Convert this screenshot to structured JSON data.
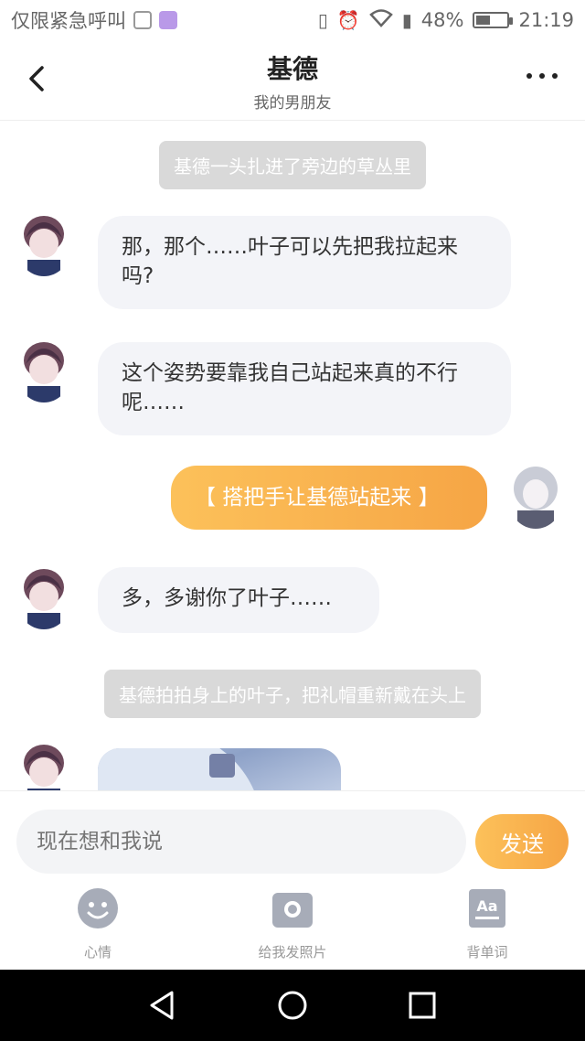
{
  "status_bar": {
    "carrier": "仅限紧急呼叫",
    "battery": "48%",
    "battery_level": 0.48,
    "time": "21:19"
  },
  "header": {
    "title": "基德",
    "subtitle": "我的男朋友"
  },
  "messages": {
    "sys1": "基德一头扎进了旁边的草丛里",
    "m1": "那，那个……叶子可以先把我拉起来吗?",
    "m2": "这个姿势要靠我自己站起来真的不行呢……",
    "m3": "【 搭把手让基德站起来 】",
    "m4": "多，多谢你了叶子……",
    "sys2": "基德拍拍身上的叶子，把礼帽重新戴在头上"
  },
  "input": {
    "placeholder": "现在想和我说",
    "send_label": "发送"
  },
  "tools": {
    "mood": "心情",
    "photo": "给我发照片",
    "words": "背单词"
  },
  "colors": {
    "accent_start": "#fcc15a",
    "accent_end": "#f6a545",
    "bubble_bg": "#f3f4f8",
    "system_bg": "#d9d9d9"
  }
}
